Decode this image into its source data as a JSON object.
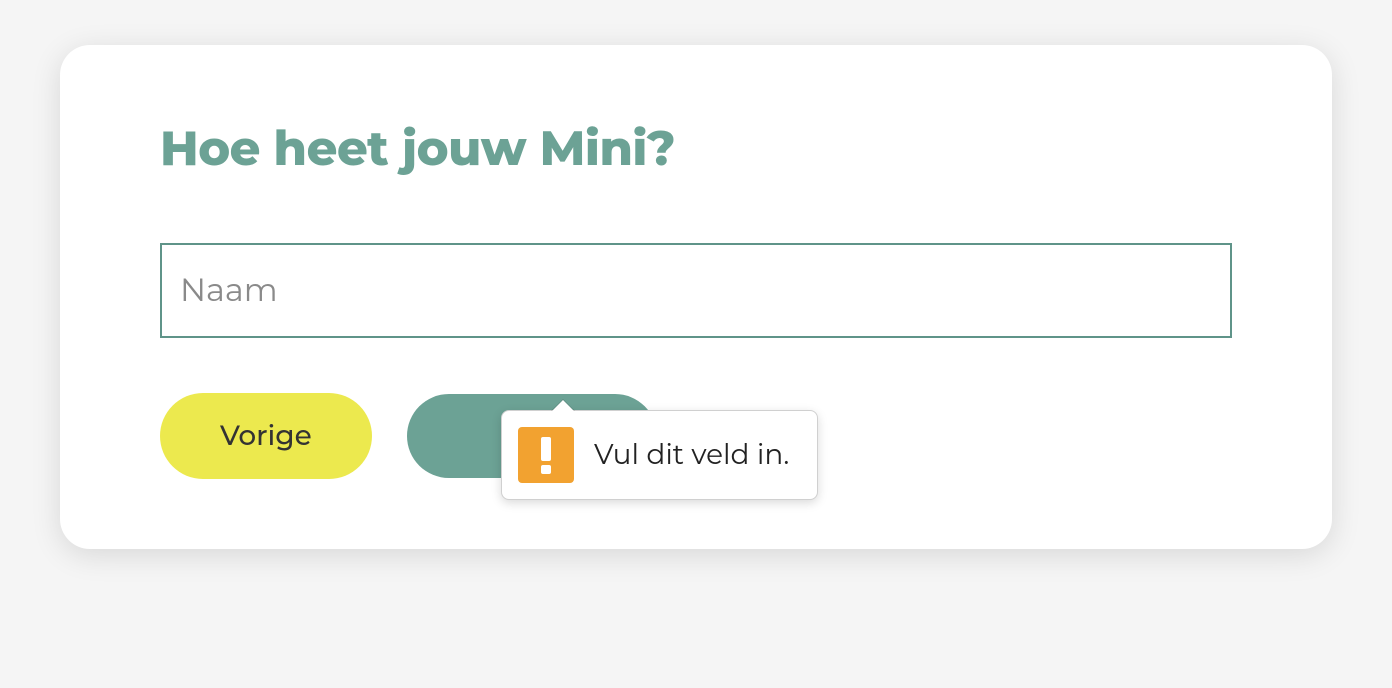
{
  "form": {
    "title": "Hoe heet jouw Mini?",
    "name_input": {
      "placeholder": "Naam",
      "value": ""
    },
    "buttons": {
      "previous": "Vorige",
      "next": ""
    }
  },
  "validation": {
    "message": "Vul dit veld in.",
    "icon": "warning-icon"
  }
}
